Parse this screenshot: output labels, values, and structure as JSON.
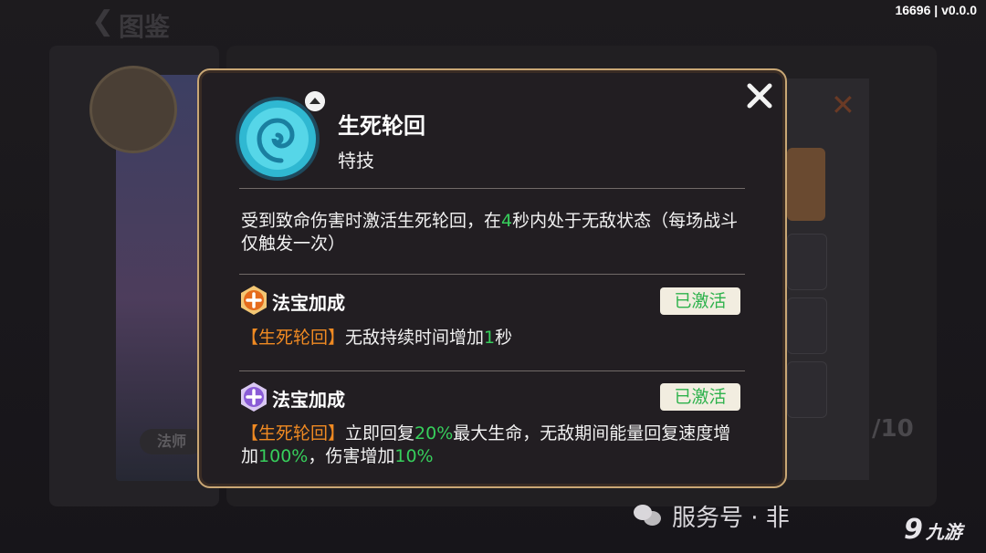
{
  "app": {
    "version_label": "16696 | v0.0.0",
    "back_glyph": "❮",
    "page_title": "图鉴",
    "class_tab": "法师",
    "page_count": "/10"
  },
  "skill": {
    "name": "生死轮回",
    "type": "特技",
    "desc_parts": [
      "受到致命伤害时激活生死轮回，在",
      "4",
      "秒内处于无敌状态（每场战斗仅触发一次）"
    ]
  },
  "bonuses": [
    {
      "title": "法宝加成",
      "status": "已激活",
      "icon": "orange-treasure-icon",
      "tag": "【生死轮回】",
      "text_parts": [
        "无敌持续时间增加",
        "1",
        "秒"
      ]
    },
    {
      "title": "法宝加成",
      "status": "已激活",
      "icon": "purple-treasure-icon",
      "tag": "【生死轮回】",
      "text_parts": [
        "立即回复",
        "20%",
        "最大生命，无敌期间能量回复速度增加",
        "100%",
        "，伤害增加",
        "10%"
      ]
    }
  ],
  "watermark": {
    "icon": "wechat-icon",
    "text": "服务号 · 非"
  },
  "site_logo": {
    "glyph": "9",
    "text": "九游"
  },
  "colors": {
    "accent_green": "#37cf5c",
    "accent_orange": "#f08a22",
    "modal_border": "#c9a775",
    "status_bg": "#f2ede0"
  }
}
